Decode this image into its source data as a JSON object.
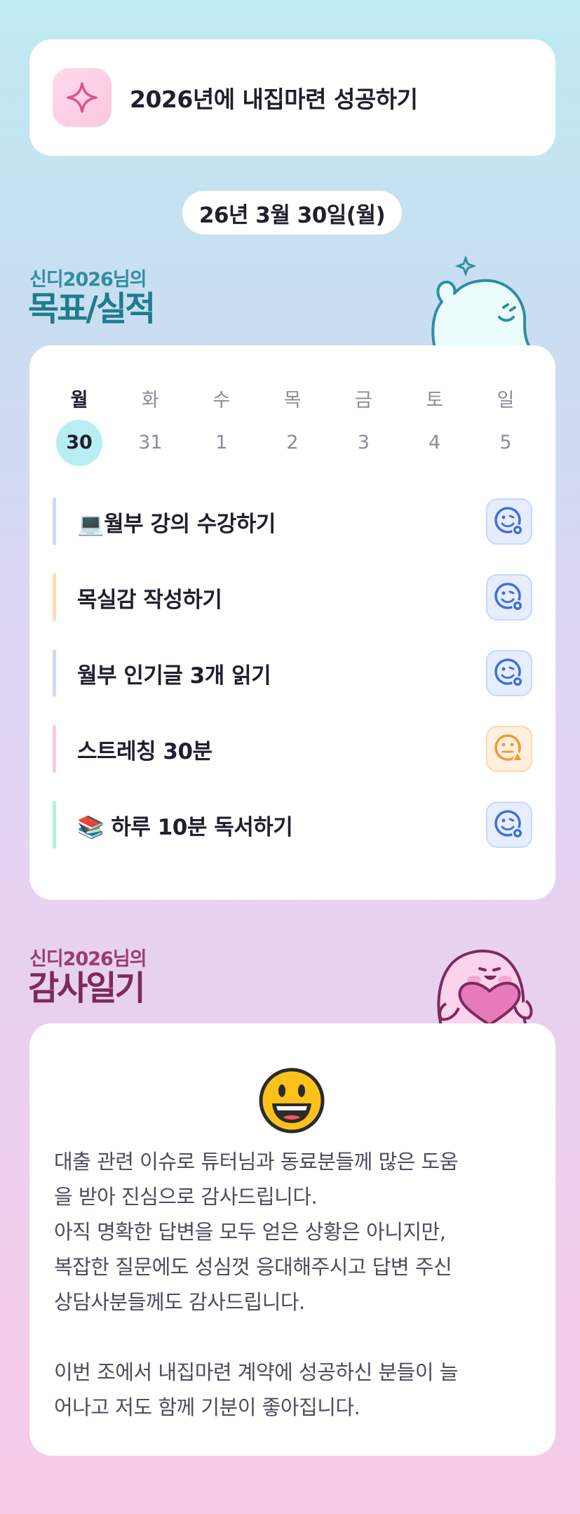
{
  "goal": {
    "title": "2026년에 내집마련 성공하기",
    "icon": "sparkle-icon"
  },
  "date_label": "26년 3월 30일(월)",
  "goals_section": {
    "subtitle": "신디2026님의",
    "title": "목표/실적"
  },
  "week": {
    "days": [
      "월",
      "화",
      "수",
      "목",
      "금",
      "토",
      "일"
    ],
    "dates": [
      "30",
      "31",
      "1",
      "2",
      "3",
      "4",
      "5"
    ],
    "active_index": 0
  },
  "tasks": [
    {
      "emoji": "💻",
      "label": "월부 강의 수강하기",
      "bar_color": "#cfd9f7",
      "status": "pending-blue"
    },
    {
      "emoji": "",
      "label": "목실감 작성하기",
      "bar_color": "#ffdcb5",
      "status": "pending-blue"
    },
    {
      "emoji": "",
      "label": "월부 인기글 3개 읽기",
      "bar_color": "#cfd9f7",
      "status": "pending-blue"
    },
    {
      "emoji": "",
      "label": "스트레칭 30분",
      "bar_color": "#f8c9e1",
      "status": "warning-orange"
    },
    {
      "emoji": "📚",
      "label": "하루 10분 독서하기",
      "bar_color": "#b9eee0",
      "status": "pending-blue"
    }
  ],
  "gratitude_section": {
    "subtitle": "신디2026님의",
    "title": "감사일기"
  },
  "diary": {
    "emoji": "😃",
    "paragraph1_lines": [
      "대출 관련 이슈로 튜터님과 동료분들께 많은 도움",
      "을 받아 진심으로 감사드립니다.",
      "아직 명확한 답변을 모두 얻은 상황은 아니지만,",
      "복잡한 질문에도 성심껏 응대해주시고 답변 주신",
      "상담사분들께도 감사드립니다."
    ],
    "paragraph2_lines": [
      "이번 조에서 내집마련 계약에 성공하신 분들이 늘",
      "어나고 저도 함께 기분이 좋아집니다."
    ]
  },
  "colors": {
    "accent_teal": "#2f8ea0",
    "accent_purple": "#8a2f6a",
    "status_blue": "#3f6fe0",
    "status_orange": "#f29a3a",
    "active_date": "#b8eef1"
  }
}
